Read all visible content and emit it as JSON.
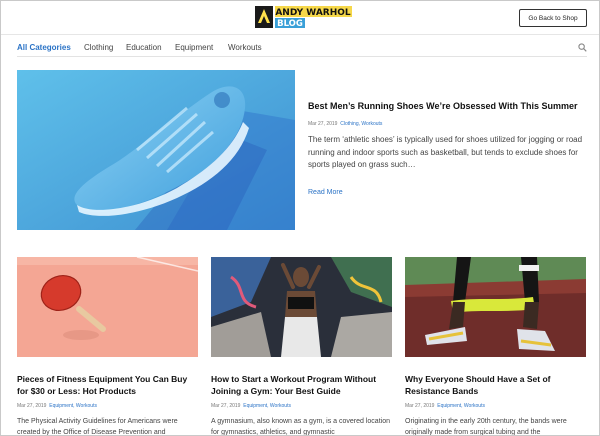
{
  "header": {
    "logo_text": [
      "ANDY WARHOL",
      "BLOG"
    ],
    "shop_button_label": "Go Back to Shop"
  },
  "nav": {
    "tabs": [
      {
        "label": "All Categories",
        "active": true
      },
      {
        "label": "Clothing",
        "active": false
      },
      {
        "label": "Education",
        "active": false
      },
      {
        "label": "Equipment",
        "active": false
      },
      {
        "label": "Workouts",
        "active": false
      }
    ],
    "search_icon": "search-icon"
  },
  "featured": {
    "title": "Best Men’s Running Shoes We’re Obsessed With This Summer",
    "date": "Mar 27, 2019",
    "categories": "Clothing, Workouts",
    "excerpt": "The term ‘athletic shoes’ is typically used for shoes utilized for jogging or road running and indoor sports such as basketball, but tends to exclude shoes for sports played on grass such…",
    "read_more": "Read More"
  },
  "posts": [
    {
      "title": "Pieces of Fitness Equipment You Can Buy for $30 or Less: Hot Products",
      "date": "Mar 27, 2019",
      "categories": "Equipment, Workouts",
      "excerpt": "The Physical Activity Guidelines for Americans were created by the Office of Disease Prevention and"
    },
    {
      "title": "How to Start a Workout Program Without Joining a Gym: Your Best Guide",
      "date": "Mar 27, 2019",
      "categories": "Equipment, Workouts",
      "excerpt": "A gymnasium, also known as a gym, is a covered location for gymnastics, athletics, and gymnastic"
    },
    {
      "title": "Why Everyone Should Have a Set of Resistance Bands",
      "date": "Mar 27, 2019",
      "categories": "Equipment, Workouts",
      "excerpt": "Originating in the early 20th century, the bands were originally made from surgical tubing and the"
    }
  ],
  "colors": {
    "accent": "#2b73c6",
    "shoe_bg": "#55b8e4",
    "pingpong_bg": "#f4a694",
    "paddle_red": "#d63a2c",
    "band_yellow": "#d9e83a"
  }
}
